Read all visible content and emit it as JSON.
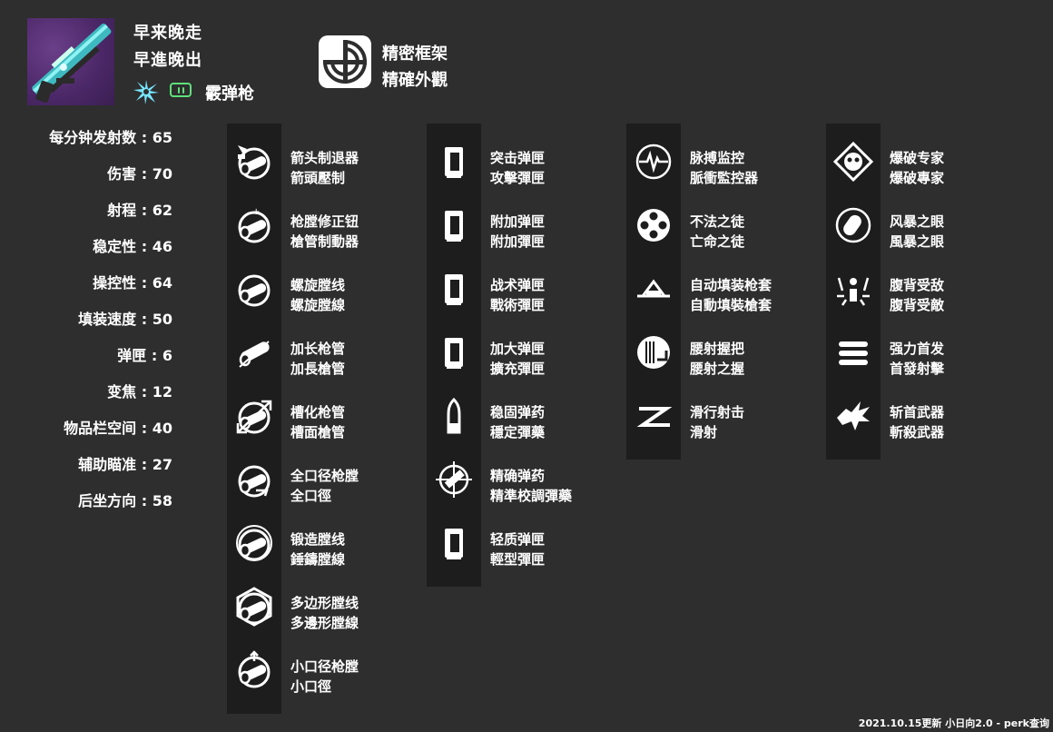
{
  "weapon": {
    "name_simplified": "早来晚走",
    "name_traditional": "早進晚出",
    "element_icon": "void-burst-icon",
    "ammo_icon": "special-ammo-icon",
    "type": "霰弹枪",
    "frame_icon": "precision-frame-icon",
    "frame_simplified": "精密框架",
    "frame_traditional": "精確外觀",
    "colors": {
      "thumb_bg": "#4a2766",
      "weapon_accent": "#4fd1d6",
      "ammo_green": "#5ee07a",
      "element_cyan": "#78e6ff"
    }
  },
  "stats": [
    {
      "label": "每分钟发射数",
      "value": "65"
    },
    {
      "label": "伤害",
      "value": "70"
    },
    {
      "label": "射程",
      "value": "62"
    },
    {
      "label": "稳定性",
      "value": "46"
    },
    {
      "label": "操控性",
      "value": "64"
    },
    {
      "label": "填装速度",
      "value": "50"
    },
    {
      "label": "弹匣",
      "value": "6"
    },
    {
      "label": "变焦",
      "value": "12"
    },
    {
      "label": "物品栏空间",
      "value": "40"
    },
    {
      "label": "辅助瞄准",
      "value": "27"
    },
    {
      "label": "后坐方向",
      "value": "58"
    }
  ],
  "columns": [
    {
      "name": "barrels",
      "perks": [
        {
          "icon": "arrowhead-brake-icon",
          "line1": "箭头制退器",
          "line2": "箭頭壓制"
        },
        {
          "icon": "corkscrew-rifling-brake-icon",
          "line1": "枪膛修正钮",
          "line2": "槍管制動器"
        },
        {
          "icon": "corkscrew-rifling-icon",
          "line1": "螺旋膛线",
          "line2": "螺旋膛線"
        },
        {
          "icon": "extended-barrel-icon",
          "line1": "加长枪管",
          "line2": "加長槍管"
        },
        {
          "icon": "fluted-barrel-icon",
          "line1": "槽化枪管",
          "line2": "槽面槍管"
        },
        {
          "icon": "full-choke-icon",
          "line1": "全口径枪膛",
          "line2": "全口徑"
        },
        {
          "icon": "hammer-forged-rifling-icon",
          "line1": "锻造膛线",
          "line2": "錘鑄膛線"
        },
        {
          "icon": "polygonal-rifling-icon",
          "line1": "多边形膛线",
          "line2": "多邊形膛線"
        },
        {
          "icon": "smallbore-icon",
          "line1": "小口径枪膛",
          "line2": "小口徑"
        }
      ]
    },
    {
      "name": "magazines",
      "perks": [
        {
          "icon": "assault-mag-icon",
          "line1": "突击弹匣",
          "line2": "攻擊彈匣"
        },
        {
          "icon": "appended-mag-icon",
          "line1": "附加弹匣",
          "line2": "附加彈匣"
        },
        {
          "icon": "tactical-mag-icon",
          "line1": "战术弹匣",
          "line2": "戰術彈匣"
        },
        {
          "icon": "extended-mag-icon",
          "line1": "加大弹匣",
          "line2": "擴充彈匣"
        },
        {
          "icon": "steady-rounds-icon",
          "line1": "稳固弹药",
          "line2": "穩定彈藥"
        },
        {
          "icon": "accurized-rounds-icon",
          "line1": "精确弹药",
          "line2": "精準校調彈藥"
        },
        {
          "icon": "light-mag-icon",
          "line1": "轻质弹匣",
          "line2": "輕型彈匣"
        }
      ]
    },
    {
      "name": "trait1",
      "perks": [
        {
          "icon": "pulse-monitor-icon",
          "line1": "脉搏监控",
          "line2": "脈衝監控器"
        },
        {
          "icon": "outlaw-icon",
          "line1": "不法之徒",
          "line2": "亡命之徒"
        },
        {
          "icon": "auto-loading-holster-icon",
          "line1": "自动填装枪套",
          "line2": "自動填裝槍套"
        },
        {
          "icon": "hip-fire-grip-icon",
          "line1": "腰射握把",
          "line2": "腰射之握"
        },
        {
          "icon": "slide-shot-icon",
          "line1": "滑行射击",
          "line2": "滑射"
        }
      ]
    },
    {
      "name": "trait2",
      "perks": [
        {
          "icon": "demolitionist-icon",
          "line1": "爆破专家",
          "line2": "爆破專家"
        },
        {
          "icon": "eye-of-the-storm-icon",
          "line1": "风暴之眼",
          "line2": "風暴之眼"
        },
        {
          "icon": "surrounded-icon",
          "line1": "腹背受敌",
          "line2": "腹背受敵"
        },
        {
          "icon": "opening-shot-icon",
          "line1": "强力首发",
          "line2": "首發射擊"
        },
        {
          "icon": "vorpal-weapon-icon",
          "line1": "斩首武器",
          "line2": "斬殺武器"
        }
      ]
    }
  ],
  "footer": "2021.10.15更新 小日向2.0 - perk查询"
}
